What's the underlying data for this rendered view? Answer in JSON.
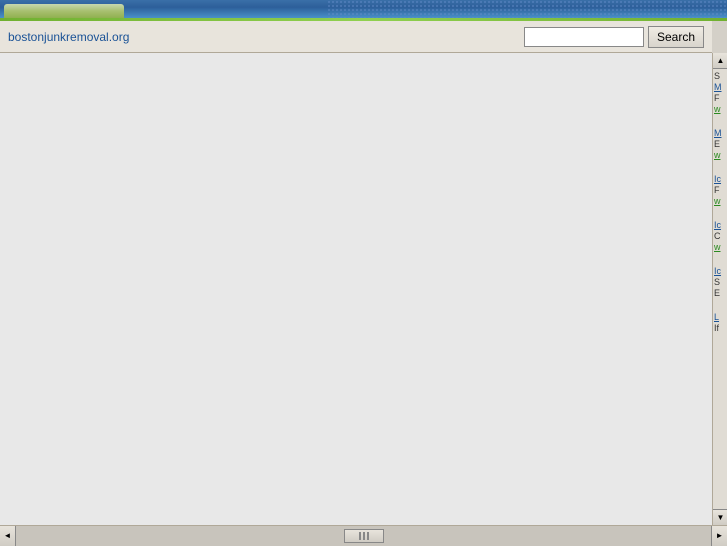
{
  "header": {
    "tab_color": "#a0c060"
  },
  "toolbar": {
    "site_url": "bostonjunkremoval.org",
    "search_placeholder": "",
    "search_button_label": "Search"
  },
  "sidebar": {
    "items": [
      {
        "lines": [
          {
            "text": "S",
            "type": "text"
          },
          {
            "text": "M",
            "type": "blue"
          },
          {
            "text": "F",
            "type": "text"
          },
          {
            "text": "w",
            "type": "green"
          }
        ]
      },
      {
        "lines": [
          {
            "text": "M",
            "type": "blue"
          },
          {
            "text": "E",
            "type": "text"
          },
          {
            "text": "w",
            "type": "green"
          }
        ]
      },
      {
        "lines": [
          {
            "text": "Ic",
            "type": "blue"
          },
          {
            "text": "F",
            "type": "text"
          },
          {
            "text": "w",
            "type": "green"
          }
        ]
      },
      {
        "lines": [
          {
            "text": "Ic",
            "type": "blue"
          },
          {
            "text": "C",
            "type": "text"
          },
          {
            "text": "w",
            "type": "green"
          }
        ]
      },
      {
        "lines": [
          {
            "text": "Ic",
            "type": "blue"
          },
          {
            "text": "S",
            "type": "text"
          },
          {
            "text": "E",
            "type": "text"
          }
        ]
      },
      {
        "lines": [
          {
            "text": "L",
            "type": "blue"
          },
          {
            "text": "If",
            "type": "text"
          }
        ]
      }
    ]
  },
  "scrollbar": {
    "left_arrow": "◄",
    "right_arrow": "►",
    "up_arrow": "▲",
    "down_arrow": "▼"
  }
}
